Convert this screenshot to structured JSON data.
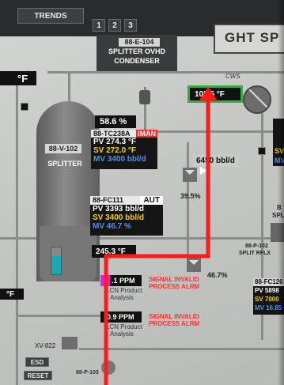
{
  "header": {
    "trends_label": "TRENDS",
    "pages": [
      "1",
      "2",
      "3"
    ],
    "screen_title": "GHT SP"
  },
  "condenser": {
    "tag": "88-E-104",
    "line1": "SPLITTER OVHD",
    "line2": "CONDENSER"
  },
  "cws_label": "CWS",
  "left_temp_top": "°F",
  "splitter": {
    "tag": "88-V-102",
    "name": "SPLITTER"
  },
  "level_percent": "58.6  %",
  "overhead_temp": "105.5  °F",
  "tc238a": {
    "tag": "88-TC238A",
    "mode": "IMAN",
    "pv_label": "PV",
    "pv": "274.3  °F",
    "sv_label": "SV",
    "sv": "272.0  °F",
    "mv_label": "MV",
    "mv": "3400  bbl/d"
  },
  "reflux_flow": "6450  bbl/d",
  "valve_pct_1": "39.5%",
  "fc111": {
    "tag": "88-FC111",
    "mode": "AUT",
    "pv_label": "PV",
    "pv": "3393  bbl/d",
    "sv_label": "SV",
    "sv": "3400  bbl/d",
    "mv_label": "MV",
    "mv": "46.7  %"
  },
  "bottoms_temp": "245.3  °F",
  "valve_pct_2": "46.7%",
  "analyzer1": {
    "value": ".1  PPM",
    "line1": "LCN Product",
    "line2": "Analysis",
    "alarm1": "SIGNAL INVALID",
    "alarm2": "PROCESS ALRM"
  },
  "analyzer2": {
    "value": "0.9  PPM",
    "line1": "LCN Product",
    "line2": "Analysis",
    "alarm1": "SIGNAL INVALID",
    "alarm2": "PROCESS ALRM"
  },
  "left_temp_bottom": "°F",
  "xv_tag": "XV-822",
  "esd_label": "ESD",
  "reset_label": "RESET",
  "pump_tag": "88-P-103",
  "right_pump_tag1": "88-P-102",
  "right_pump_tag2": "SPLIT RFLX",
  "right_partial_bl": "B",
  "right_partial_spl": "SPL",
  "fc126": {
    "tag": "88-FC126",
    "pv_label": "PV",
    "pv": "5898",
    "sv_label": "SV",
    "sv": "7000",
    "mv_label": "MV",
    "mv": "16.85"
  },
  "right_sv_partial": "SV",
  "right_mv_partial": "MV",
  "colors": {
    "annotation_arrow": "#ff1a1a",
    "alarm_text": "#ff3333",
    "magenta_box": "#e020e0",
    "green_border": "#39a845",
    "level_cyan": "#1aa7b8"
  }
}
